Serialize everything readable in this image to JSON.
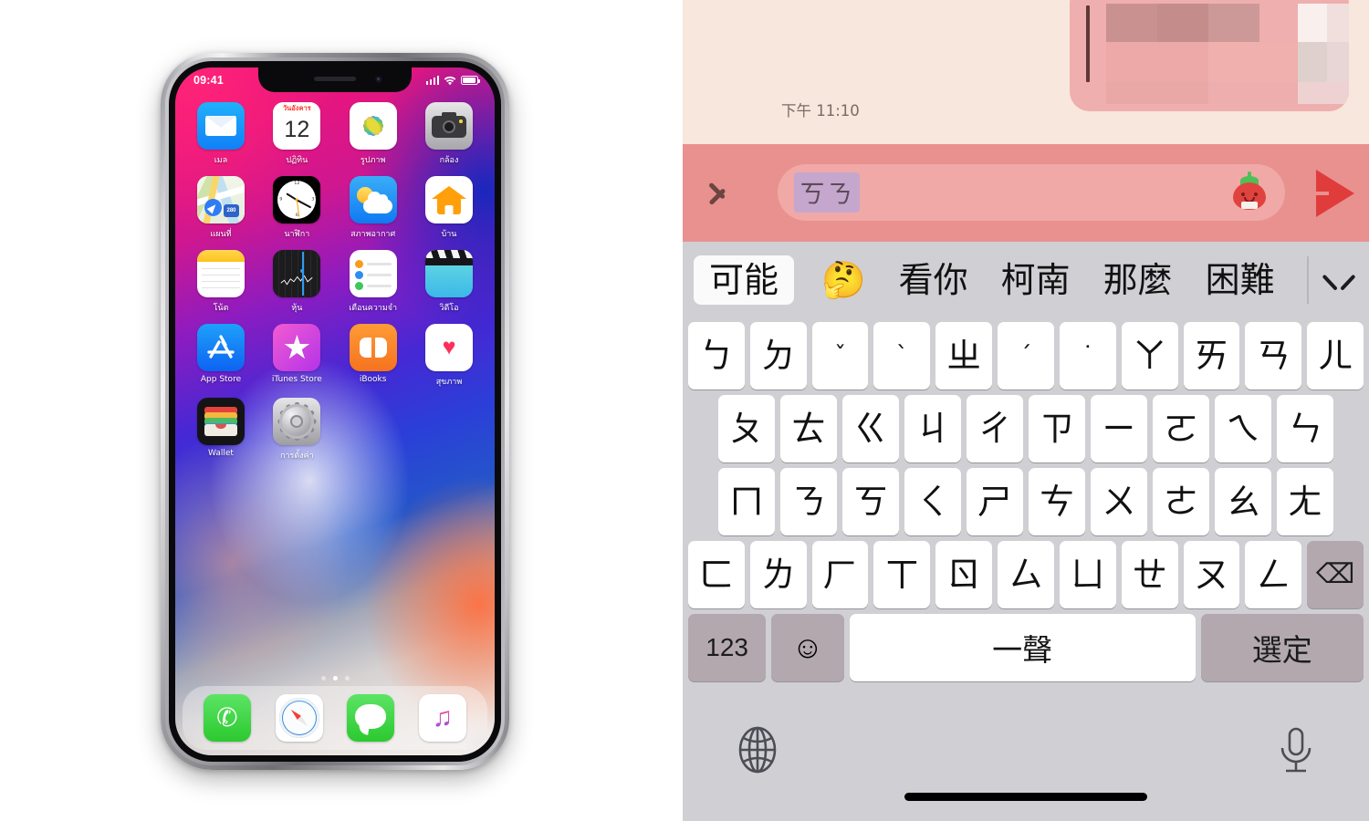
{
  "left": {
    "device_name": "iPhone X",
    "status": {
      "time": "09:41",
      "signal_icon": "cellular-bars-icon",
      "wifi_icon": "wifi-icon",
      "battery_icon": "battery-icon"
    },
    "home_screen": {
      "rows": [
        [
          {
            "label": "เมล",
            "icon": "mail-icon"
          },
          {
            "label": "ปฏิทิน",
            "icon": "calendar-icon",
            "weekday": "วันอังคาร",
            "day": "12"
          },
          {
            "label": "รูปภาพ",
            "icon": "photos-icon"
          },
          {
            "label": "กล้อง",
            "icon": "camera-icon"
          }
        ],
        [
          {
            "label": "แผนที่",
            "icon": "maps-icon",
            "route_badge": "280"
          },
          {
            "label": "นาฬิกา",
            "icon": "clock-icon"
          },
          {
            "label": "สภาพอากาศ",
            "icon": "weather-icon"
          },
          {
            "label": "บ้าน",
            "icon": "home-icon"
          }
        ],
        [
          {
            "label": "โน้ต",
            "icon": "notes-icon"
          },
          {
            "label": "หุ้น",
            "icon": "stocks-icon"
          },
          {
            "label": "เตือนความจำ",
            "icon": "reminders-icon"
          },
          {
            "label": "วิดีโอ",
            "icon": "videos-icon"
          }
        ],
        [
          {
            "label": "App Store",
            "icon": "app-store-icon"
          },
          {
            "label": "iTunes Store",
            "icon": "itunes-store-icon"
          },
          {
            "label": "iBooks",
            "icon": "ibooks-icon"
          },
          {
            "label": "สุขภาพ",
            "icon": "health-icon"
          }
        ],
        [
          {
            "label": "Wallet",
            "icon": "wallet-icon"
          },
          {
            "label": "การตั้งค่า",
            "icon": "settings-icon"
          }
        ]
      ],
      "page_dots": {
        "count": 3,
        "active_index": 1
      },
      "dock": [
        {
          "label": "Phone",
          "icon": "phone-icon",
          "glyph": "✆"
        },
        {
          "label": "Safari",
          "icon": "safari-icon"
        },
        {
          "label": "Messages",
          "icon": "messages-icon"
        },
        {
          "label": "Music",
          "icon": "music-icon",
          "glyph": "♫"
        }
      ]
    }
  },
  "right": {
    "chat": {
      "message_time": "下午 11:10",
      "bubble_redacted": true
    },
    "input_bar": {
      "expand_icon": "chevron-right-icon",
      "composing_text": "ㄎㄋ",
      "sticker_icon": "strawberry-sticker-icon",
      "send_icon": "send-arrow-icon"
    },
    "candidates": {
      "selected": "可能",
      "emoji": "🤔",
      "items": [
        "看你",
        "柯南",
        "那麼",
        "困難"
      ],
      "expand_icon": "chevron-down-icon"
    },
    "keyboard": {
      "rows": [
        [
          "ㄅ",
          "ㄉ",
          "ˇ",
          "ˋ",
          "ㄓ",
          "ˊ",
          "˙",
          "ㄚ",
          "ㄞ",
          "ㄢ",
          "ㄦ"
        ],
        [
          "ㄆ",
          "ㄊ",
          "ㄍ",
          "ㄐ",
          "ㄔ",
          "ㄗ",
          "ㄧ",
          "ㄛ",
          "ㄟ",
          "ㄣ"
        ],
        [
          "ㄇ",
          "ㄋ",
          "ㄎ",
          "ㄑ",
          "ㄕ",
          "ㄘ",
          "ㄨ",
          "ㄜ",
          "ㄠ",
          "ㄤ"
        ],
        [
          "ㄈ",
          "ㄌ",
          "ㄏ",
          "ㄒ",
          "ㄖ",
          "ㄙ",
          "ㄩ",
          "ㄝ",
          "ㄡ",
          "ㄥ"
        ]
      ],
      "backspace_icon": "backspace-icon",
      "backspace_glyph": "⌫",
      "numeric_key": "123",
      "emoji_key_icon": "emoji-face-icon",
      "emoji_key_glyph": "☺",
      "space_key": "一聲",
      "enter_key": "選定",
      "globe_icon": "globe-icon",
      "mic_icon": "microphone-icon",
      "home_indicator": "home-indicator"
    }
  }
}
